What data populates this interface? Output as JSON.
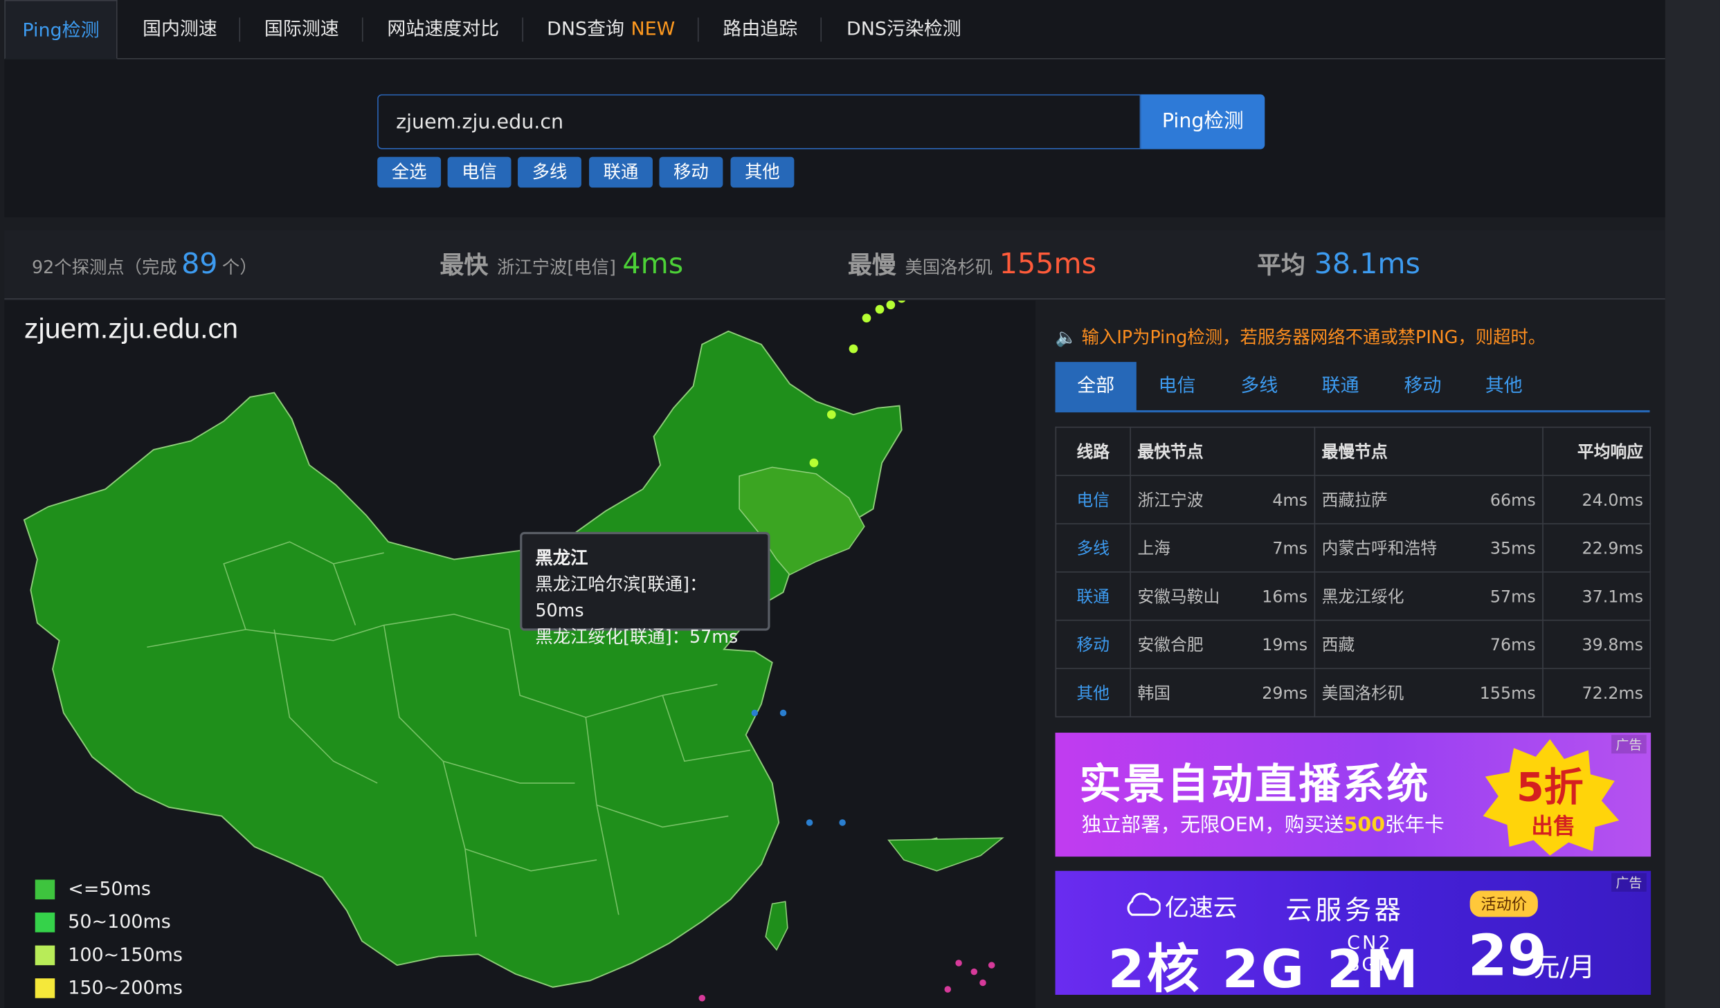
{
  "tabs": [
    {
      "label": "Ping检测",
      "active": true
    },
    {
      "label": "国内测速"
    },
    {
      "label": "国际测速"
    },
    {
      "label": "网站速度对比"
    },
    {
      "label": "DNS查询",
      "badge": "NEW"
    },
    {
      "label": "路由追踪"
    },
    {
      "label": "DNS污染检测"
    }
  ],
  "search": {
    "value": "zjuem.zju.edu.cn",
    "button": "Ping检测"
  },
  "filters": [
    "全选",
    "电信",
    "多线",
    "联通",
    "移动",
    "其他"
  ],
  "stats": {
    "probe_prefix": "92个探测点（完成",
    "probe_done": "89",
    "probe_suffix": "个）",
    "fastest_label": "最快",
    "fastest_node": "浙江宁波[电信]",
    "fastest_value": "4ms",
    "slowest_label": "最慢",
    "slowest_node": "美国洛杉矶",
    "slowest_value": "155ms",
    "avg_label": "平均",
    "avg_value": "38.1ms"
  },
  "map": {
    "title": "zjuem.zju.edu.cn",
    "tooltip": {
      "title": "黑龙江",
      "line1": "黑龙江哈尔滨[联通]：50ms",
      "line2": "黑龙江绥化[联通]：57ms"
    },
    "legend": [
      {
        "label": "<=50ms",
        "color": "#3ec43e"
      },
      {
        "label": "50~100ms",
        "color": "#35d24a"
      },
      {
        "label": "100~150ms",
        "color": "#b8ec58"
      },
      {
        "label": "150~200ms",
        "color": "#f5e83a"
      }
    ]
  },
  "notice": "输入IP为Ping检测，若服务器网络不通或禁PING，则超时。",
  "result_tabs": [
    "全部",
    "电信",
    "多线",
    "联通",
    "移动",
    "其他"
  ],
  "table": {
    "headers": [
      "线路",
      "最快节点",
      "最慢节点",
      "平均响应"
    ],
    "rows": [
      {
        "line": "电信",
        "fast": "浙江宁波",
        "fast_ms": "4ms",
        "slow": "西藏拉萨",
        "slow_ms": "66ms",
        "avg": "24.0ms"
      },
      {
        "line": "多线",
        "fast": "上海",
        "fast_ms": "7ms",
        "slow": "内蒙古呼和浩特",
        "slow_ms": "35ms",
        "avg": "22.9ms"
      },
      {
        "line": "联通",
        "fast": "安徽马鞍山",
        "fast_ms": "16ms",
        "slow": "黑龙江绥化",
        "slow_ms": "57ms",
        "avg": "37.1ms"
      },
      {
        "line": "移动",
        "fast": "安徽合肥",
        "fast_ms": "19ms",
        "slow": "西藏",
        "slow_ms": "76ms",
        "avg": "39.8ms"
      },
      {
        "line": "其他",
        "fast": "韩国",
        "fast_ms": "29ms",
        "slow": "美国洛杉矶",
        "slow_ms": "155ms",
        "avg": "72.2ms"
      }
    ]
  },
  "ad1": {
    "tag": "广告",
    "headline": "实景自动直播系统",
    "sub_prefix": "独立部署，无限OEM，购买送",
    "sub_highlight": "500",
    "sub_suffix": "张年卡",
    "burst_big": "5折",
    "burst_small": "出售"
  },
  "ad2": {
    "tag": "广告",
    "brand": "亿速云",
    "product": "云服务器",
    "badge": "活动价",
    "spec": "2核 2G 2M",
    "cn2": "CN2",
    "bgp": "BGP",
    "price": "29",
    "unit": "元/月"
  }
}
